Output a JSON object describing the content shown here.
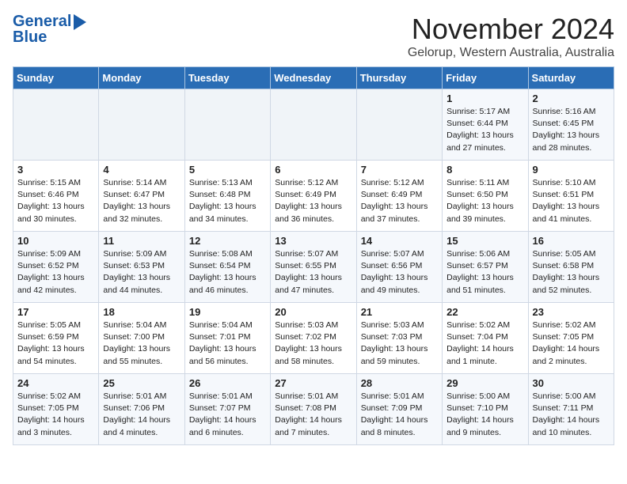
{
  "logo": {
    "line1": "General",
    "line2": "Blue"
  },
  "title": "November 2024",
  "subtitle": "Gelorup, Western Australia, Australia",
  "weekdays": [
    "Sunday",
    "Monday",
    "Tuesday",
    "Wednesday",
    "Thursday",
    "Friday",
    "Saturday"
  ],
  "weeks": [
    [
      {
        "day": "",
        "info": ""
      },
      {
        "day": "",
        "info": ""
      },
      {
        "day": "",
        "info": ""
      },
      {
        "day": "",
        "info": ""
      },
      {
        "day": "",
        "info": ""
      },
      {
        "day": "1",
        "info": "Sunrise: 5:17 AM\nSunset: 6:44 PM\nDaylight: 13 hours\nand 27 minutes."
      },
      {
        "day": "2",
        "info": "Sunrise: 5:16 AM\nSunset: 6:45 PM\nDaylight: 13 hours\nand 28 minutes."
      }
    ],
    [
      {
        "day": "3",
        "info": "Sunrise: 5:15 AM\nSunset: 6:46 PM\nDaylight: 13 hours\nand 30 minutes."
      },
      {
        "day": "4",
        "info": "Sunrise: 5:14 AM\nSunset: 6:47 PM\nDaylight: 13 hours\nand 32 minutes."
      },
      {
        "day": "5",
        "info": "Sunrise: 5:13 AM\nSunset: 6:48 PM\nDaylight: 13 hours\nand 34 minutes."
      },
      {
        "day": "6",
        "info": "Sunrise: 5:12 AM\nSunset: 6:49 PM\nDaylight: 13 hours\nand 36 minutes."
      },
      {
        "day": "7",
        "info": "Sunrise: 5:12 AM\nSunset: 6:49 PM\nDaylight: 13 hours\nand 37 minutes."
      },
      {
        "day": "8",
        "info": "Sunrise: 5:11 AM\nSunset: 6:50 PM\nDaylight: 13 hours\nand 39 minutes."
      },
      {
        "day": "9",
        "info": "Sunrise: 5:10 AM\nSunset: 6:51 PM\nDaylight: 13 hours\nand 41 minutes."
      }
    ],
    [
      {
        "day": "10",
        "info": "Sunrise: 5:09 AM\nSunset: 6:52 PM\nDaylight: 13 hours\nand 42 minutes."
      },
      {
        "day": "11",
        "info": "Sunrise: 5:09 AM\nSunset: 6:53 PM\nDaylight: 13 hours\nand 44 minutes."
      },
      {
        "day": "12",
        "info": "Sunrise: 5:08 AM\nSunset: 6:54 PM\nDaylight: 13 hours\nand 46 minutes."
      },
      {
        "day": "13",
        "info": "Sunrise: 5:07 AM\nSunset: 6:55 PM\nDaylight: 13 hours\nand 47 minutes."
      },
      {
        "day": "14",
        "info": "Sunrise: 5:07 AM\nSunset: 6:56 PM\nDaylight: 13 hours\nand 49 minutes."
      },
      {
        "day": "15",
        "info": "Sunrise: 5:06 AM\nSunset: 6:57 PM\nDaylight: 13 hours\nand 51 minutes."
      },
      {
        "day": "16",
        "info": "Sunrise: 5:05 AM\nSunset: 6:58 PM\nDaylight: 13 hours\nand 52 minutes."
      }
    ],
    [
      {
        "day": "17",
        "info": "Sunrise: 5:05 AM\nSunset: 6:59 PM\nDaylight: 13 hours\nand 54 minutes."
      },
      {
        "day": "18",
        "info": "Sunrise: 5:04 AM\nSunset: 7:00 PM\nDaylight: 13 hours\nand 55 minutes."
      },
      {
        "day": "19",
        "info": "Sunrise: 5:04 AM\nSunset: 7:01 PM\nDaylight: 13 hours\nand 56 minutes."
      },
      {
        "day": "20",
        "info": "Sunrise: 5:03 AM\nSunset: 7:02 PM\nDaylight: 13 hours\nand 58 minutes."
      },
      {
        "day": "21",
        "info": "Sunrise: 5:03 AM\nSunset: 7:03 PM\nDaylight: 13 hours\nand 59 minutes."
      },
      {
        "day": "22",
        "info": "Sunrise: 5:02 AM\nSunset: 7:04 PM\nDaylight: 14 hours\nand 1 minute."
      },
      {
        "day": "23",
        "info": "Sunrise: 5:02 AM\nSunset: 7:05 PM\nDaylight: 14 hours\nand 2 minutes."
      }
    ],
    [
      {
        "day": "24",
        "info": "Sunrise: 5:02 AM\nSunset: 7:05 PM\nDaylight: 14 hours\nand 3 minutes."
      },
      {
        "day": "25",
        "info": "Sunrise: 5:01 AM\nSunset: 7:06 PM\nDaylight: 14 hours\nand 4 minutes."
      },
      {
        "day": "26",
        "info": "Sunrise: 5:01 AM\nSunset: 7:07 PM\nDaylight: 14 hours\nand 6 minutes."
      },
      {
        "day": "27",
        "info": "Sunrise: 5:01 AM\nSunset: 7:08 PM\nDaylight: 14 hours\nand 7 minutes."
      },
      {
        "day": "28",
        "info": "Sunrise: 5:01 AM\nSunset: 7:09 PM\nDaylight: 14 hours\nand 8 minutes."
      },
      {
        "day": "29",
        "info": "Sunrise: 5:00 AM\nSunset: 7:10 PM\nDaylight: 14 hours\nand 9 minutes."
      },
      {
        "day": "30",
        "info": "Sunrise: 5:00 AM\nSunset: 7:11 PM\nDaylight: 14 hours\nand 10 minutes."
      }
    ]
  ]
}
